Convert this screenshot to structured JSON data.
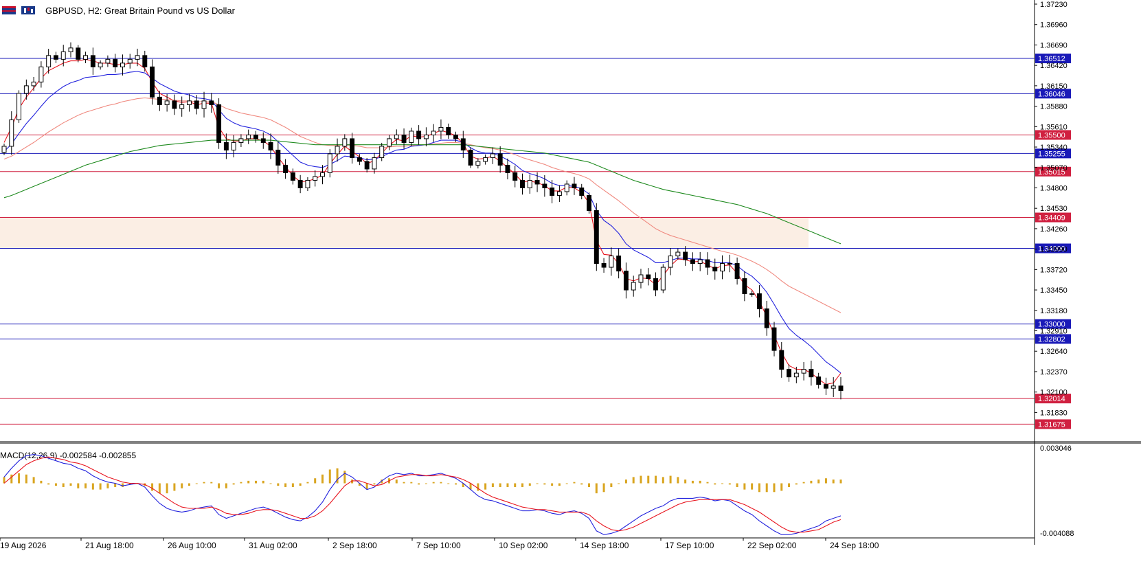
{
  "header": {
    "symbol_info": "GBPUSD, H2:  Great Britain Pound vs US Dollar"
  },
  "macd": {
    "label": "MACD(12,26,9) -0.002584 -0.002855",
    "axis_top": "0.003046",
    "axis_bottom": "-0.004088"
  },
  "chart_data": {
    "type": "candlestick",
    "symbol": "GBPUSD",
    "timeframe": "H2",
    "title": "GBPUSD, H2:  Great Britain Pound vs US Dollar",
    "ylim": [
      1.3147,
      1.3723
    ],
    "y_ticks": [
      "1.37230",
      "1.36960",
      "1.36690",
      "1.36420",
      "1.36150",
      "1.35880",
      "1.35610",
      "1.35340",
      "1.35070",
      "1.34800",
      "1.34530",
      "1.34260",
      "1.33990",
      "1.33720",
      "1.33450",
      "1.33180",
      "1.32910",
      "1.32640",
      "1.32370",
      "1.32100",
      "1.31830"
    ],
    "x_ticks": [
      "19 Aug 2026",
      "21 Aug 18:00",
      "26 Aug 10:00",
      "31 Aug 02:00",
      "2 Sep 18:00",
      "7 Sep 10:00",
      "10 Sep 02:00",
      "14 Sep 18:00",
      "17 Sep 10:00",
      "22 Sep 02:00",
      "24 Sep 18:00"
    ],
    "grid": false,
    "horizontal_levels": [
      {
        "value": 1.36512,
        "label": "1.36512",
        "color": "#1a1ab8"
      },
      {
        "value": 1.36046,
        "label": "1.36046",
        "color": "#1a1ab8"
      },
      {
        "value": 1.355,
        "label": "1.35500",
        "color": "#d02040"
      },
      {
        "value": 1.35255,
        "label": "1.35255",
        "color": "#1a1ab8"
      },
      {
        "value": 1.35015,
        "label": "1.35015",
        "color": "#d02040"
      },
      {
        "value": 1.34409,
        "label": "1.34409",
        "color": "#d02040"
      },
      {
        "value": 1.34,
        "label": "1.34000",
        "color": "#1a1ab8"
      },
      {
        "value": 1.33,
        "label": "1.33000",
        "color": "#1a1ab8"
      },
      {
        "value": 1.32802,
        "label": "1.32802",
        "color": "#1a1ab8"
      },
      {
        "value": 1.32014,
        "label": "1.32014",
        "color": "#d02040"
      },
      {
        "value": 1.31675,
        "label": "1.31675",
        "color": "#d02040"
      }
    ],
    "zone": {
      "from": 1.34,
      "to": 1.34409,
      "color": "#fbeee4"
    },
    "close_series": [
      1.3535,
      1.357,
      1.3605,
      1.3615,
      1.362,
      1.364,
      1.3655,
      1.365,
      1.366,
      1.3665,
      1.365,
      1.3655,
      1.364,
      1.3645,
      1.365,
      1.364,
      1.3645,
      1.365,
      1.3655,
      1.364,
      1.36,
      1.359,
      1.3595,
      1.3585,
      1.359,
      1.3595,
      1.3585,
      1.3595,
      1.359,
      1.354,
      1.353,
      1.354,
      1.3545,
      1.355,
      1.3545,
      1.354,
      1.353,
      1.351,
      1.35,
      1.349,
      1.348,
      1.349,
      1.3495,
      1.35,
      1.3525,
      1.3535,
      1.3545,
      1.352,
      1.3515,
      1.3505,
      1.352,
      1.3535,
      1.3545,
      1.355,
      1.354,
      1.3555,
      1.3545,
      1.355,
      1.3555,
      1.356,
      1.355,
      1.3545,
      1.353,
      1.351,
      1.3515,
      1.352,
      1.3525,
      1.351,
      1.35,
      1.349,
      1.348,
      1.349,
      1.3485,
      1.348,
      1.347,
      1.3475,
      1.3485,
      1.348,
      1.347,
      1.345,
      1.338,
      1.3375,
      1.339,
      1.337,
      1.3345,
      1.3355,
      1.3365,
      1.336,
      1.3345,
      1.3375,
      1.339,
      1.3395,
      1.3385,
      1.338,
      1.3385,
      1.3375,
      1.337,
      1.338,
      1.338,
      1.336,
      1.334,
      1.334,
      1.332,
      1.3295,
      1.3265,
      1.324,
      1.323,
      1.3235,
      1.324,
      1.323,
      1.322,
      1.3215,
      1.3218,
      1.3212
    ],
    "series": [
      {
        "name": "MA fast",
        "color": "#e8141e",
        "values": [
          1.354,
          1.356,
          1.3585,
          1.36,
          1.3612,
          1.3625,
          1.3635,
          1.364,
          1.3645,
          1.3648,
          1.3648,
          1.365,
          1.3648,
          1.3645,
          1.3645,
          1.3643,
          1.3643,
          1.3645,
          1.3645,
          1.3638,
          1.362,
          1.3605,
          1.36,
          1.3595,
          1.3593,
          1.3594,
          1.359,
          1.3592,
          1.3592,
          1.356,
          1.3545,
          1.3542,
          1.3542,
          1.3545,
          1.3545,
          1.3542,
          1.3535,
          1.352,
          1.3508,
          1.3496,
          1.3488,
          1.3489,
          1.3492,
          1.3497,
          1.3512,
          1.3524,
          1.3535,
          1.3528,
          1.3521,
          1.3512,
          1.3516,
          1.3526,
          1.3536,
          1.3544,
          1.3542,
          1.3549,
          1.3547,
          1.3548,
          1.3552,
          1.3556,
          1.3553,
          1.3549,
          1.3538,
          1.3522,
          1.3518,
          1.3519,
          1.3522,
          1.3515,
          1.3507,
          1.3498,
          1.3488,
          1.3489,
          1.3487,
          1.3483,
          1.3476,
          1.3476,
          1.3481,
          1.348,
          1.3474,
          1.346,
          1.341,
          1.3392,
          1.3391,
          1.338,
          1.336,
          1.3357,
          1.3361,
          1.336,
          1.3352,
          1.3364,
          1.3377,
          1.3386,
          1.3385,
          1.3382,
          1.3383,
          1.3378,
          1.3373,
          1.3377,
          1.3378,
          1.3367,
          1.3352,
          1.3345,
          1.333,
          1.331,
          1.3285,
          1.3262,
          1.3245,
          1.324,
          1.324,
          1.3235,
          1.3227,
          1.322,
          1.3222,
          1.3235
        ]
      },
      {
        "name": "MA mid",
        "color": "#2222dd",
        "values": [
          1.3528,
          1.3538,
          1.3552,
          1.3565,
          1.3576,
          1.3588,
          1.3599,
          1.3607,
          1.3614,
          1.3619,
          1.3622,
          1.3626,
          1.3627,
          1.3628,
          1.363,
          1.363,
          1.3631,
          1.3633,
          1.3634,
          1.3632,
          1.3625,
          1.3618,
          1.3613,
          1.3608,
          1.3605,
          1.3603,
          1.3599,
          1.3598,
          1.3596,
          1.3583,
          1.3572,
          1.3566,
          1.3562,
          1.356,
          1.3558,
          1.3555,
          1.355,
          1.3541,
          1.3532,
          1.3523,
          1.3514,
          1.351,
          1.3508,
          1.3507,
          1.3511,
          1.3516,
          1.3522,
          1.3521,
          1.352,
          1.3517,
          1.3518,
          1.3521,
          1.3526,
          1.353,
          1.3531,
          1.3535,
          1.3536,
          1.3537,
          1.354,
          1.3543,
          1.3543,
          1.3543,
          1.354,
          1.3533,
          1.3528,
          1.3526,
          1.3526,
          1.3522,
          1.3517,
          1.3511,
          1.3503,
          1.3499,
          1.3496,
          1.3492,
          1.3486,
          1.3483,
          1.3483,
          1.3482,
          1.3479,
          1.3472,
          1.345,
          1.3437,
          1.343,
          1.342,
          1.3406,
          1.3398,
          1.3393,
          1.3388,
          1.3381,
          1.3381,
          1.3384,
          1.3387,
          1.3387,
          1.3386,
          1.3386,
          1.3384,
          1.3381,
          1.3381,
          1.3381,
          1.3377,
          1.3369,
          1.3363,
          1.3354,
          1.3342,
          1.3326,
          1.3309,
          1.3294,
          1.3285,
          1.3278,
          1.327,
          1.326,
          1.325,
          1.3243,
          1.3235
        ]
      },
      {
        "name": "MA slow",
        "color": "#f08a80",
        "values": [
          1.3518,
          1.3522,
          1.3528,
          1.3534,
          1.354,
          1.3547,
          1.3554,
          1.356,
          1.3566,
          1.3571,
          1.3576,
          1.358,
          1.3583,
          1.3586,
          1.3589,
          1.3591,
          1.3594,
          1.3596,
          1.3598,
          1.3599,
          1.3598,
          1.3597,
          1.3597,
          1.3596,
          1.3595,
          1.3595,
          1.3594,
          1.3594,
          1.3594,
          1.359,
          1.3585,
          1.3582,
          1.3579,
          1.3577,
          1.3575,
          1.3573,
          1.357,
          1.3565,
          1.356,
          1.3554,
          1.3548,
          1.3544,
          1.354,
          1.3537,
          1.3536,
          1.3536,
          1.3537,
          1.3536,
          1.3535,
          1.3533,
          1.3533,
          1.3533,
          1.3534,
          1.3535,
          1.3535,
          1.3536,
          1.3537,
          1.3537,
          1.3538,
          1.3539,
          1.354,
          1.354,
          1.3539,
          1.3537,
          1.3535,
          1.3533,
          1.3532,
          1.353,
          1.3527,
          1.3524,
          1.352,
          1.3517,
          1.3514,
          1.3511,
          1.3507,
          1.3504,
          1.3501,
          1.3499,
          1.3496,
          1.3492,
          1.3484,
          1.3477,
          1.347,
          1.3463,
          1.3455,
          1.3447,
          1.344,
          1.3433,
          1.3426,
          1.3421,
          1.3417,
          1.3414,
          1.3411,
          1.3408,
          1.3405,
          1.3402,
          1.3399,
          1.3396,
          1.3394,
          1.3391,
          1.3387,
          1.3383,
          1.3378,
          1.3372,
          1.3365,
          1.3357,
          1.335,
          1.3345,
          1.334,
          1.3335,
          1.333,
          1.3325,
          1.332,
          1.3315
        ]
      },
      {
        "name": "MA long",
        "color": "#1e8a1e",
        "values": [
          1.3467,
          1.347,
          1.3474,
          1.3478,
          1.3482,
          1.3486,
          1.349,
          1.3494,
          1.3498,
          1.3502,
          1.3506,
          1.351,
          1.3513,
          1.3516,
          1.3519,
          1.3522,
          1.3525,
          1.3528,
          1.353,
          1.3532,
          1.3534,
          1.3536,
          1.3537,
          1.3538,
          1.3539,
          1.354,
          1.3541,
          1.3542,
          1.3543,
          1.3543,
          1.3543,
          1.3543,
          1.3543,
          1.3543,
          1.3543,
          1.3543,
          1.3543,
          1.3542,
          1.3541,
          1.354,
          1.3539,
          1.3538,
          1.3537,
          1.3537,
          1.3537,
          1.3537,
          1.3537,
          1.3537,
          1.3537,
          1.3537,
          1.3537,
          1.3537,
          1.3537,
          1.3537,
          1.3537,
          1.3537,
          1.3537,
          1.3537,
          1.3537,
          1.3537,
          1.3537,
          1.3537,
          1.3537,
          1.3536,
          1.3535,
          1.3534,
          1.3533,
          1.3532,
          1.3531,
          1.353,
          1.3529,
          1.3528,
          1.3527,
          1.3526,
          1.3524,
          1.3522,
          1.352,
          1.3518,
          1.3516,
          1.3514,
          1.351,
          1.3506,
          1.3502,
          1.3498,
          1.3494,
          1.349,
          1.3487,
          1.3484,
          1.3481,
          1.3478,
          1.3476,
          1.3474,
          1.3472,
          1.347,
          1.3468,
          1.3466,
          1.3464,
          1.3462,
          1.346,
          1.3458,
          1.3455,
          1.3452,
          1.3449,
          1.3446,
          1.3442,
          1.3438,
          1.3434,
          1.343,
          1.3426,
          1.3422,
          1.3418,
          1.3414,
          1.341,
          1.3406
        ]
      }
    ],
    "macd": {
      "params": "12,26,9",
      "ylim": [
        -0.004088,
        0.003046
      ],
      "main": [
        0.0005,
        0.0012,
        0.0018,
        0.0022,
        0.0023,
        0.0022,
        0.002,
        0.0018,
        0.0016,
        0.0015,
        0.0012,
        0.001,
        0.0006,
        0.0003,
        0.0001,
        0.0,
        -0.0002,
        -0.0001,
        0.0,
        -0.0003,
        -0.001,
        -0.0016,
        -0.002,
        -0.0022,
        -0.0023,
        -0.0022,
        -0.002,
        -0.0019,
        -0.0018,
        -0.0025,
        -0.0028,
        -0.0026,
        -0.0024,
        -0.0022,
        -0.002,
        -0.0019,
        -0.0021,
        -0.0024,
        -0.0027,
        -0.0029,
        -0.003,
        -0.0027,
        -0.0022,
        -0.0015,
        -0.0005,
        0.0003,
        0.0008,
        0.0005,
        0.0,
        -0.0005,
        -0.0003,
        0.0002,
        0.0006,
        0.0008,
        0.0007,
        0.0008,
        0.0006,
        0.0006,
        0.0007,
        0.0008,
        0.0006,
        0.0004,
        0.0,
        -0.0005,
        -0.001,
        -0.0013,
        -0.0014,
        -0.0016,
        -0.0018,
        -0.002,
        -0.0022,
        -0.0022,
        -0.0021,
        -0.0022,
        -0.0024,
        -0.0025,
        -0.0023,
        -0.0022,
        -0.0024,
        -0.0028,
        -0.0038,
        -0.0041,
        -0.004,
        -0.0038,
        -0.0034,
        -0.003,
        -0.0026,
        -0.0023,
        -0.002,
        -0.0018,
        -0.0014,
        -0.0012,
        -0.0012,
        -0.0012,
        -0.0011,
        -0.0012,
        -0.0014,
        -0.0013,
        -0.0014,
        -0.0018,
        -0.0022,
        -0.0025,
        -0.003,
        -0.0034,
        -0.0038,
        -0.0041,
        -0.0041,
        -0.004,
        -0.0038,
        -0.0036,
        -0.0034,
        -0.003,
        -0.0028,
        -0.0026
      ],
      "signal": [
        0.0,
        0.0005,
        0.001,
        0.0015,
        0.0018,
        0.002,
        0.0021,
        0.002,
        0.0019,
        0.0017,
        0.0016,
        0.0014,
        0.0011,
        0.0008,
        0.0005,
        0.0003,
        0.0001,
        0.0,
        0.0,
        -0.0001,
        -0.0004,
        -0.0008,
        -0.0012,
        -0.0016,
        -0.0019,
        -0.002,
        -0.002,
        -0.002,
        -0.0019,
        -0.0021,
        -0.0024,
        -0.0025,
        -0.0025,
        -0.0024,
        -0.0022,
        -0.0021,
        -0.0021,
        -0.0022,
        -0.0024,
        -0.0026,
        -0.0028,
        -0.0028,
        -0.0026,
        -0.0022,
        -0.0016,
        -0.0009,
        -0.0002,
        0.0002,
        0.0002,
        0.0,
        -0.0002,
        -0.0001,
        0.0002,
        0.0005,
        0.0006,
        0.0007,
        0.0007,
        0.0006,
        0.0006,
        0.0007,
        0.0006,
        0.0005,
        0.0003,
        0.0,
        -0.0004,
        -0.0008,
        -0.0011,
        -0.0013,
        -0.0015,
        -0.0017,
        -0.0019,
        -0.002,
        -0.0021,
        -0.0021,
        -0.0022,
        -0.0023,
        -0.0023,
        -0.0023,
        -0.0023,
        -0.0025,
        -0.003,
        -0.0034,
        -0.0037,
        -0.0038,
        -0.0037,
        -0.0035,
        -0.0032,
        -0.0029,
        -0.0026,
        -0.0023,
        -0.002,
        -0.0017,
        -0.0015,
        -0.0014,
        -0.0013,
        -0.0013,
        -0.0013,
        -0.0013,
        -0.0013,
        -0.0015,
        -0.0017,
        -0.002,
        -0.0023,
        -0.0027,
        -0.0031,
        -0.0035,
        -0.0038,
        -0.0039,
        -0.0039,
        -0.0038,
        -0.0037,
        -0.0034,
        -0.0031,
        -0.0029
      ]
    }
  },
  "colors": {
    "candle": "#000000",
    "axis_text": "#000000",
    "level_label_text": "#ffffff",
    "macd_hist": "#d9a520",
    "macd_main": "#2222dd",
    "macd_signal": "#e8141e"
  }
}
